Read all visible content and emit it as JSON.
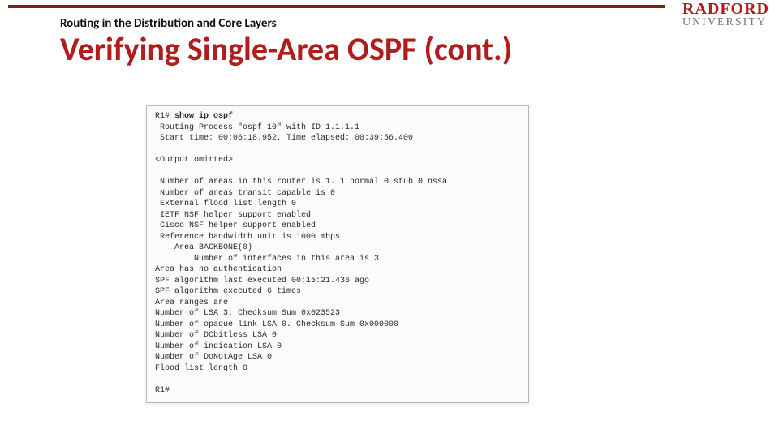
{
  "logo": {
    "brand": "RADFORD",
    "sub": "UNIVERSITY"
  },
  "kicker": "Routing in the Distribution and Core Layers",
  "title": "Verifying Single-Area OSPF (cont.)",
  "terminal": {
    "prompt": "R1# ",
    "command": "show ip ospf",
    "block1": " Routing Process \"ospf 10\" with ID 1.1.1.1\n Start time: 00:06:18.952, Time elapsed: 00:39:56.400",
    "omitted": "<Output omitted>",
    "block2": " Number of areas in this router is 1. 1 normal 0 stub 0 nssa\n Number of areas transit capable is 0\n External flood list length 0\n IETF NSF helper support enabled\n Cisco NSF helper support enabled\n Reference bandwidth unit is 1000 mbps\n    Area BACKBONE(0)\n        Number of interfaces in this area is 3\nArea has no authentication\nSPF algorithm last executed 00:15:21.436 ago\nSPF algorithm executed 6 times\nArea ranges are\nNumber of LSA 3. Checksum Sum 0x023523\nNumber of opaque link LSA 0. Checksum Sum 0x000000\nNumber of DCbitless LSA 0\nNumber of indication LSA 0\nNumber of DoNotAge LSA 0\nFlood list length 0",
    "prompt_end": "R1#"
  }
}
